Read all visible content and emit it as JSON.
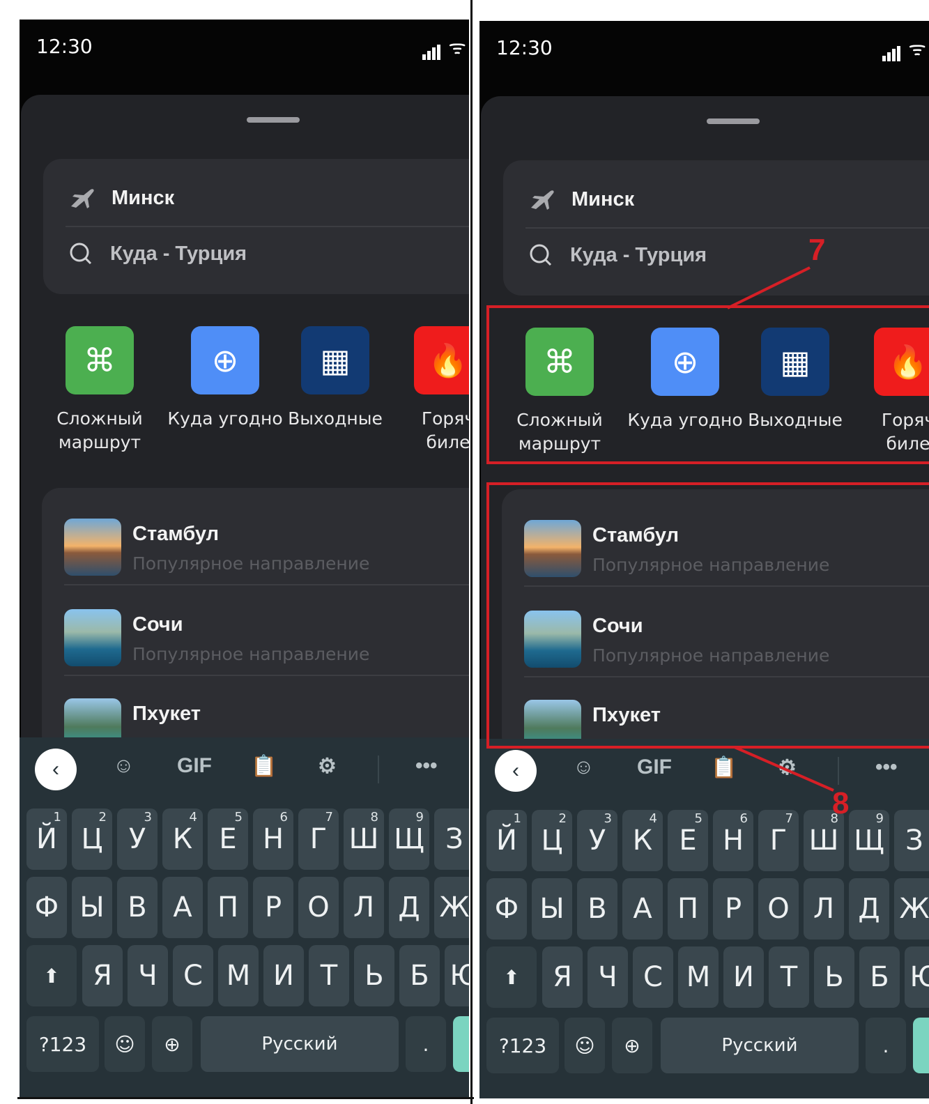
{
  "status": {
    "time": "12:30"
  },
  "search": {
    "from": "Минск",
    "to": "Куда - Турция",
    "clear": "×"
  },
  "actions": [
    {
      "label_1": "Сложный",
      "label_2": "маршрут",
      "icon": "command-icon",
      "color": "#4caf50",
      "glyph": "⌘"
    },
    {
      "label_1": "Куда угодно",
      "label_2": "",
      "icon": "globe-icon",
      "color": "#4f8ef7",
      "glyph": "⊕"
    },
    {
      "label_1": "Выходные",
      "label_2": "",
      "icon": "calendar-icon",
      "color": "#123a73",
      "glyph": "▦"
    },
    {
      "label_1": "Горяч",
      "label_2": "биле",
      "icon": "fire-icon",
      "color": "#ef1c1c",
      "glyph": "🔥"
    }
  ],
  "destinations": [
    {
      "name": "Стамбул",
      "subtitle": "Популярное направление"
    },
    {
      "name": "Сочи",
      "subtitle": "Популярное направление"
    },
    {
      "name": "Пхукет",
      "subtitle": ""
    }
  ],
  "keyboard": {
    "toolbar": {
      "gif": "GIF",
      "more": "•••"
    },
    "row1": [
      {
        "k": "Й",
        "n": "1"
      },
      {
        "k": "Ц",
        "n": "2"
      },
      {
        "k": "У",
        "n": "3"
      },
      {
        "k": "К",
        "n": "4"
      },
      {
        "k": "Е",
        "n": "5"
      },
      {
        "k": "Н",
        "n": "6"
      },
      {
        "k": "Г",
        "n": "7"
      },
      {
        "k": "Ш",
        "n": "8"
      },
      {
        "k": "Щ",
        "n": "9"
      },
      {
        "k": "З",
        "n": ""
      }
    ],
    "row2": [
      "Ф",
      "Ы",
      "В",
      "А",
      "П",
      "Р",
      "О",
      "Л",
      "Д",
      "Ж"
    ],
    "row3": [
      "Я",
      "Ч",
      "С",
      "М",
      "И",
      "Т",
      "Ь",
      "Б",
      "Ю"
    ],
    "symbols": "?123",
    "space": "Русский",
    "period": "."
  },
  "annotations": {
    "label_7": "7",
    "label_8": "8",
    "color": "#d61f26"
  }
}
